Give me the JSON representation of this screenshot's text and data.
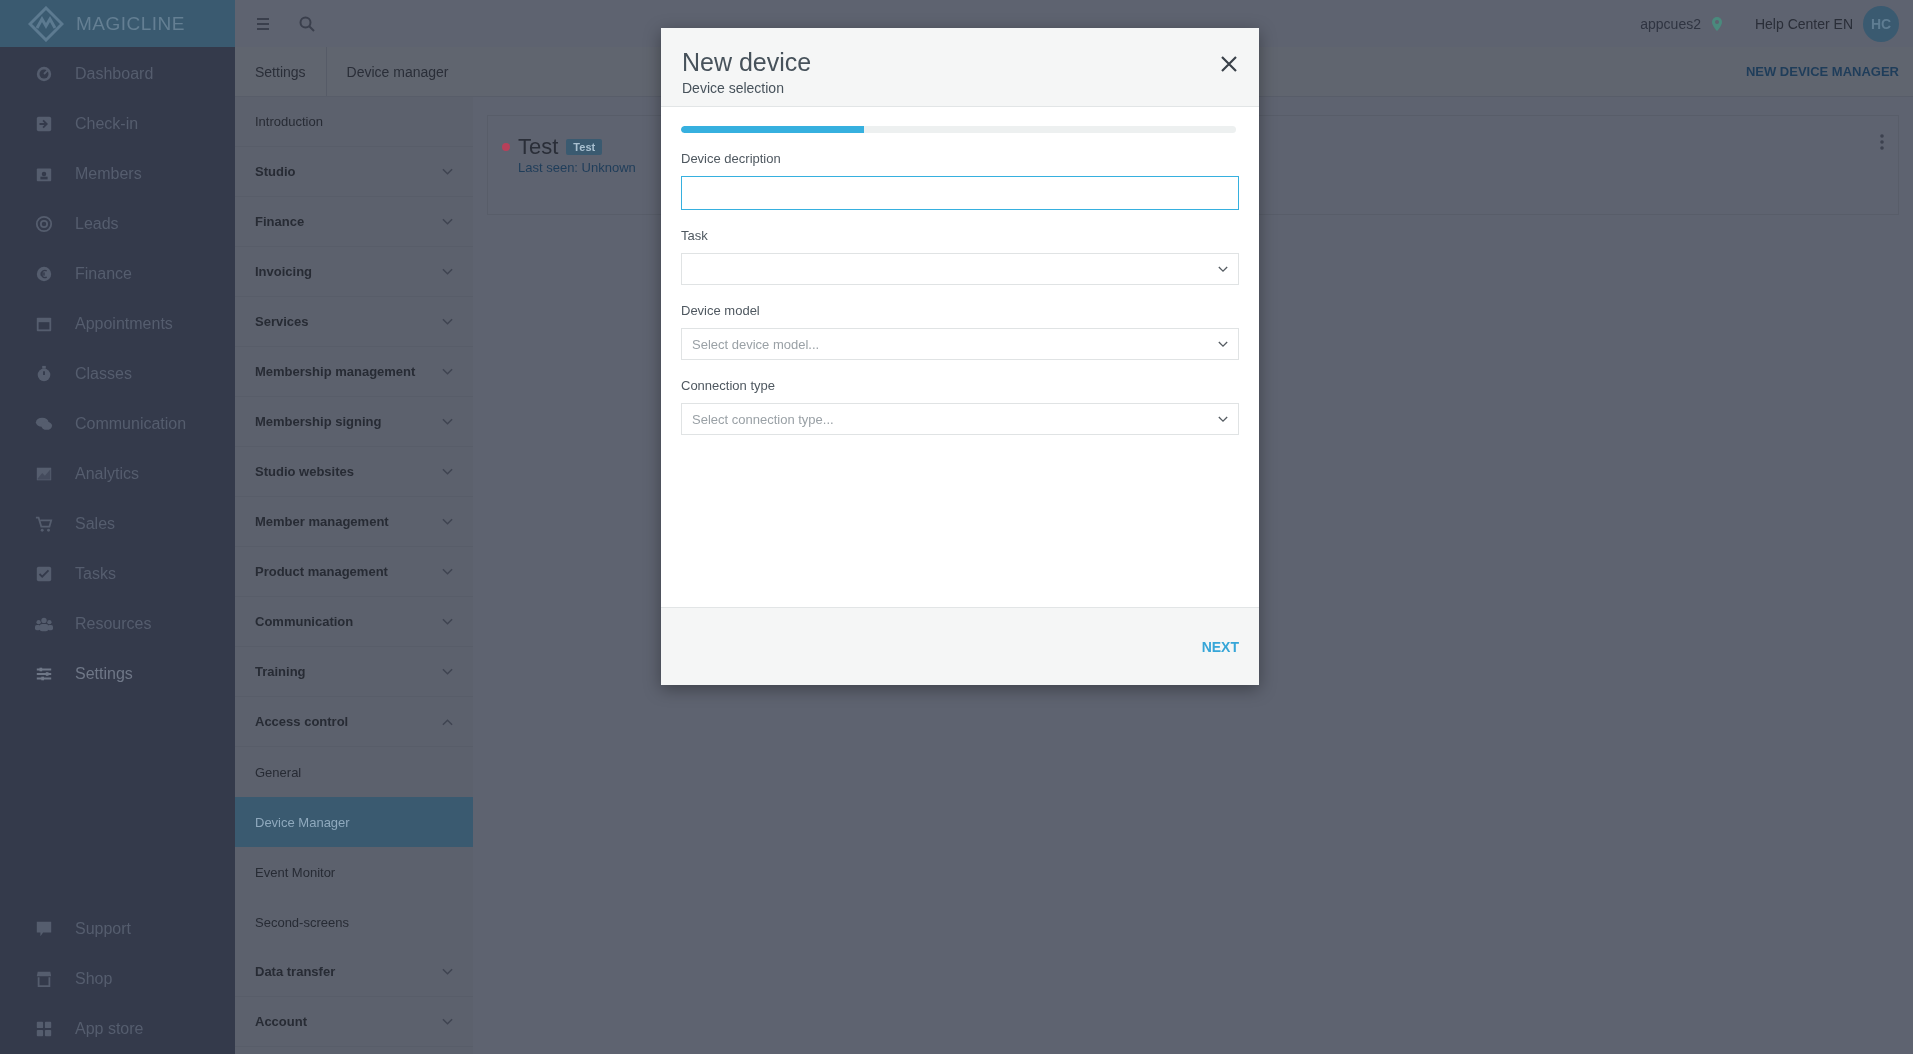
{
  "brand": {
    "name": "MAGICLINE"
  },
  "topbar": {
    "studio": "appcues2",
    "help": "Help Center EN",
    "avatar": "HC"
  },
  "sidebar": {
    "items": [
      {
        "label": "Dashboard",
        "selected": false
      },
      {
        "label": "Check-in",
        "selected": false
      },
      {
        "label": "Members",
        "selected": false
      },
      {
        "label": "Leads",
        "selected": false
      },
      {
        "label": "Finance",
        "selected": false
      },
      {
        "label": "Appointments",
        "selected": false
      },
      {
        "label": "Classes",
        "selected": false
      },
      {
        "label": "Communication",
        "selected": false
      },
      {
        "label": "Analytics",
        "selected": false
      },
      {
        "label": "Sales",
        "selected": false
      },
      {
        "label": "Tasks",
        "selected": false
      },
      {
        "label": "Resources",
        "selected": false
      },
      {
        "label": "Settings",
        "selected": true
      }
    ],
    "bottom_items": [
      {
        "label": "Support"
      },
      {
        "label": "Shop"
      },
      {
        "label": "App store"
      }
    ]
  },
  "breadcrumb": [
    "Settings",
    "Device manager"
  ],
  "header_action": "NEW DEVICE MANAGER",
  "settings_menu": [
    {
      "label": "Introduction",
      "kind": "link"
    },
    {
      "label": "Studio",
      "kind": "group",
      "expanded": false
    },
    {
      "label": "Finance",
      "kind": "group",
      "expanded": false
    },
    {
      "label": "Invoicing",
      "kind": "group",
      "expanded": false
    },
    {
      "label": "Services",
      "kind": "group",
      "expanded": false
    },
    {
      "label": "Membership management",
      "kind": "group",
      "expanded": false
    },
    {
      "label": "Membership signing",
      "kind": "group",
      "expanded": false
    },
    {
      "label": "Studio websites",
      "kind": "group",
      "expanded": false
    },
    {
      "label": "Member management",
      "kind": "group",
      "expanded": false
    },
    {
      "label": "Product management",
      "kind": "group",
      "expanded": false
    },
    {
      "label": "Communication",
      "kind": "group",
      "expanded": false
    },
    {
      "label": "Training",
      "kind": "group",
      "expanded": false
    },
    {
      "label": "Access control",
      "kind": "group",
      "expanded": true,
      "children": [
        {
          "label": "General",
          "selected": false
        },
        {
          "label": "Device Manager",
          "selected": true
        },
        {
          "label": "Event Monitor",
          "selected": false
        },
        {
          "label": "Second-screens",
          "selected": false
        }
      ]
    },
    {
      "label": "Data transfer",
      "kind": "group",
      "expanded": false
    },
    {
      "label": "Account",
      "kind": "group",
      "expanded": false
    }
  ],
  "device_card": {
    "name": "Test",
    "badge": "Test",
    "online": false,
    "last_seen": "Last seen: Unknown"
  },
  "dialog": {
    "title": "New device",
    "subtitle": "Device selection",
    "progress": {
      "level": 0.33
    },
    "fields": [
      {
        "kind": "input",
        "label": "Device decription",
        "focused": true
      },
      {
        "kind": "select",
        "label": "Task",
        "focused": false
      },
      {
        "kind": "select",
        "label": "Device model",
        "placeholder": "Select device model...",
        "focused": false
      },
      {
        "kind": "select",
        "label": "Connection type",
        "placeholder": "Select connection type...",
        "focused": false
      }
    ],
    "next": "NEXT"
  }
}
